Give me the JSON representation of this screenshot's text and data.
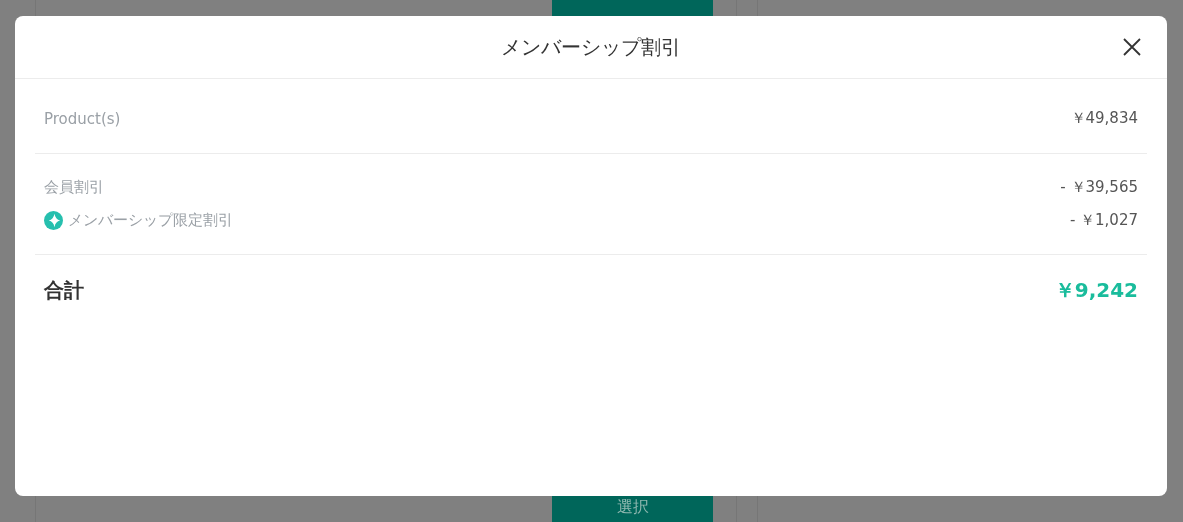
{
  "background": {
    "bottom_card": {
      "button_label": "選択"
    }
  },
  "modal": {
    "title": "メンバーシップ割引",
    "subtotal": {
      "label": "Product(s)",
      "amount": "￥49,834"
    },
    "discounts": [
      {
        "kind": "plain",
        "label": "会員割引",
        "amount": "- ￥39,565"
      },
      {
        "kind": "membership",
        "label": "メンバーシップ限定割引",
        "amount": "- ￥1,027"
      }
    ],
    "total": {
      "label": "合計",
      "amount": "￥9,242"
    }
  }
}
